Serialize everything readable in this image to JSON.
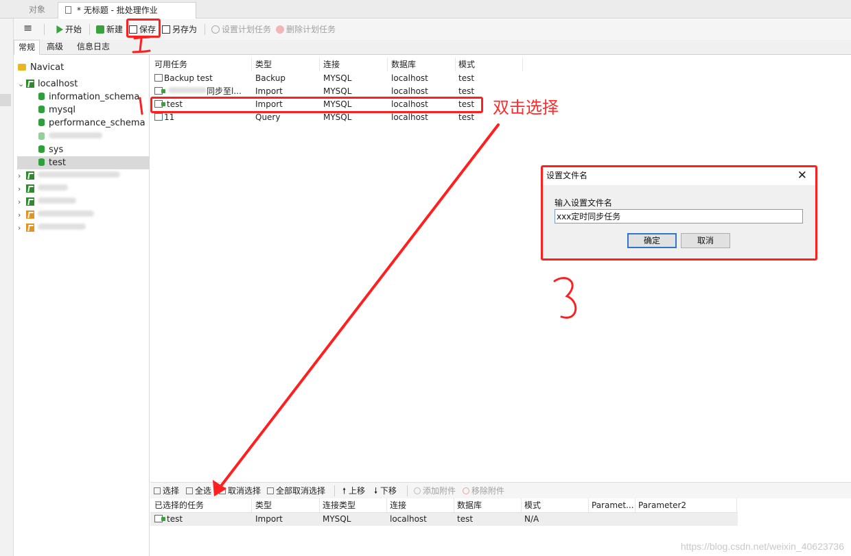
{
  "tabs": {
    "objects": "对象",
    "active": "* 无标题 - 批处理作业"
  },
  "toolbar": {
    "menu": "≡",
    "start": "开始",
    "new": "新建",
    "save": "保存",
    "save_as": "另存为",
    "set_schedule": "设置计划任务",
    "delete_schedule": "删除计划任务"
  },
  "subtabs": [
    "常规",
    "高级",
    "信息日志"
  ],
  "tree": {
    "root": "Navicat",
    "connection": "localhost",
    "databases": [
      "information_schema",
      "mysql",
      "performance_schema",
      "sys",
      "test"
    ]
  },
  "task_table": {
    "headers": [
      "可用任务",
      "类型",
      "连接",
      "数据库",
      "模式"
    ],
    "rows": [
      {
        "name": "Backup test",
        "type": "Backup",
        "conn": "MYSQL",
        "db": "localhost",
        "schema": "test"
      },
      {
        "name": "同步至l...",
        "type": "Import",
        "conn": "MYSQL",
        "db": "localhost",
        "schema": "test"
      },
      {
        "name": "test",
        "type": "Import",
        "conn": "MYSQL",
        "db": "localhost",
        "schema": "test"
      },
      {
        "name": "11",
        "type": "Query",
        "conn": "MYSQL",
        "db": "localhost",
        "schema": "test"
      }
    ]
  },
  "bottom_toolbar": {
    "select": "选择",
    "select_all": "全选",
    "deselect": "取消选择",
    "deselect_all": "全部取消选择",
    "move_up": "上移",
    "move_down": "下移",
    "add_attachment": "添加附件",
    "remove_attachment": "移除附件"
  },
  "selected_table": {
    "headers": [
      "已选择的任务",
      "类型",
      "连接类型",
      "连接",
      "数据库",
      "模式",
      "Paramet...",
      "Parameter2"
    ],
    "rows": [
      {
        "name": "test",
        "type": "Import",
        "conn_type": "MYSQL",
        "conn": "localhost",
        "db": "test",
        "schema": "N/A"
      }
    ]
  },
  "dialog": {
    "title": "设置文件名",
    "label": "输入设置文件名",
    "value": "xxx定时同步任务",
    "ok": "确定",
    "cancel": "取消"
  },
  "annotations": {
    "double_click": "双击选择"
  },
  "watermark": "https://blog.csdn.net/weixin_40623736",
  "colors": {
    "annotation_red": "#ff1f1f",
    "db_green": "#2e9f3a"
  }
}
